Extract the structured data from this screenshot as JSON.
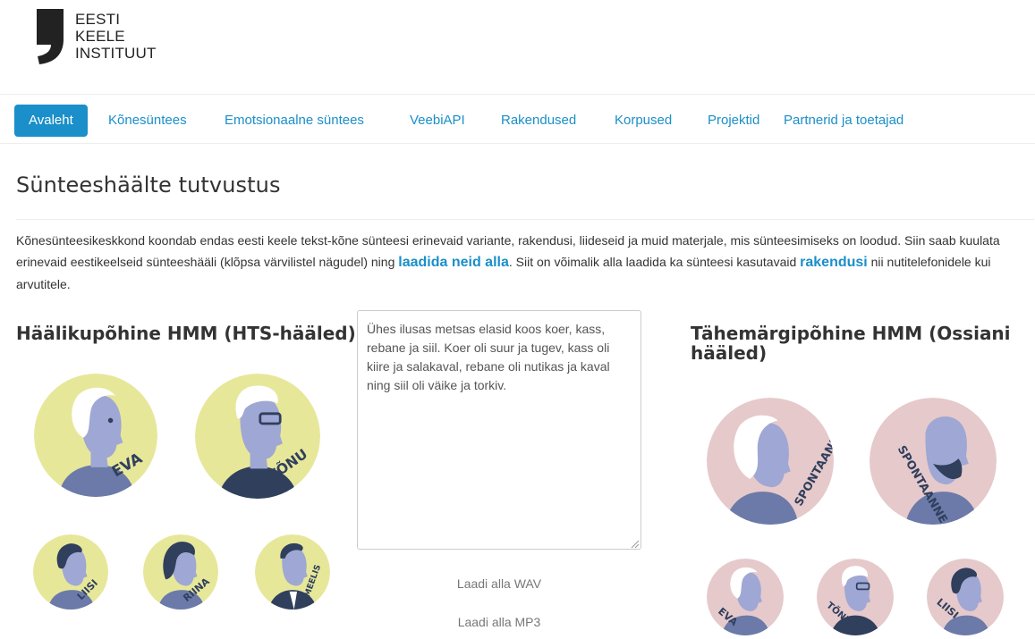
{
  "logo": {
    "lines": [
      "EESTI",
      "KEELE",
      "INSTITUUT"
    ]
  },
  "nav": {
    "items": [
      {
        "label": "Avaleht",
        "active": true
      },
      {
        "label": "Kõnesüntees",
        "active": false
      },
      {
        "label": "Emotsionaalne süntees",
        "active": false
      },
      {
        "label": "VeebiAPI",
        "active": false
      },
      {
        "label": "Rakendused",
        "active": false
      },
      {
        "label": "Korpused",
        "active": false
      },
      {
        "label": "Projektid",
        "active": false
      },
      {
        "label": "Partnerid ja toetajad",
        "active": false
      }
    ]
  },
  "page": {
    "title": "Sünteeshäälte tutvustus",
    "intro": {
      "part1": "Kõnesünteesikeskkond koondab endas eesti keele tekst-kõne sünteesi erinevaid variante, rakendusi, liideseid ja muid materjale, mis sünteesimiseks on loodud. Siin saab kuulata erinevaid eestikeelseid sünteeshääli (klõpsa värvilistel nägudel) ning ",
      "link1": "laadida neid alla",
      "part2": ". Siit on võimalik alla laadida ka sünteesi kasutavaid ",
      "link2": "rakendusi",
      "part3": " nii nutitelefonidele kui arvutitele."
    }
  },
  "left": {
    "title": "Häälikupõhine HMM (HTS-hääled)",
    "voices": [
      "EVA",
      "TÕNU",
      "LIISI",
      "RIINA",
      "MEELIS"
    ]
  },
  "center": {
    "text": "Ühes ilusas metsas elasid koos koer, kass, rebane ja siil. Koer oli suur ja tugev, kass oli kiire ja salakaval, rebane oli nutikas ja kaval ning siil oli väike ja torkiv.",
    "download_wav": "Laadi alla WAV",
    "download_mp3": "Laadi alla MP3"
  },
  "right": {
    "title": "Tähemärgipõhine HMM (Ossiani hääled)",
    "voices": [
      "SPONTAANNE",
      "SPONTAANNE",
      "EVA",
      "TÕNU",
      "LIISI"
    ]
  },
  "colors": {
    "accent": "#1a8fc9",
    "yellow_bg": "#e7e79a",
    "pink_bg": "#e6c9cb",
    "face": "#9fa7d4",
    "navy": "#2f3f5c"
  }
}
